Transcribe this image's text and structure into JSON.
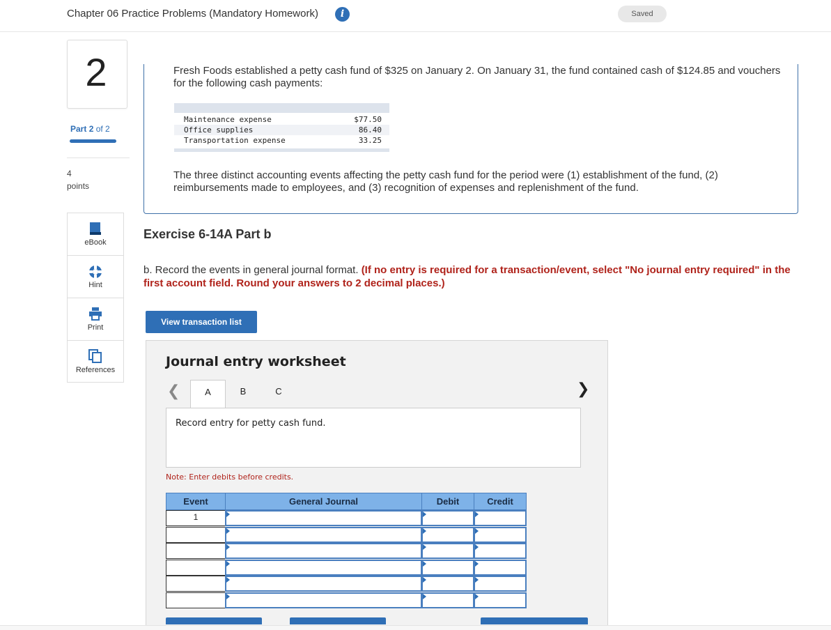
{
  "header": {
    "title": "Chapter 06 Practice Problems (Mandatory Homework)",
    "info_icon": "i",
    "saved": "Saved"
  },
  "rail": {
    "question_number": "2",
    "part_word": "Part",
    "part_current": "2",
    "part_of": "of 2",
    "progress": 1.0,
    "points_value": "4",
    "points_label": "points",
    "tools": [
      {
        "label": "eBook",
        "icon": "book-icon"
      },
      {
        "label": "Hint",
        "icon": "hint-icon"
      },
      {
        "label": "Print",
        "icon": "print-icon"
      },
      {
        "label": "References",
        "icon": "references-icon"
      }
    ]
  },
  "question": {
    "intro": "Fresh Foods established a petty cash fund of $325 on January 2. On January 31, the fund contained cash of $124.85 and vouchers for the following cash payments:",
    "payments": [
      {
        "account": "Maintenance expense",
        "amount": "$77.50"
      },
      {
        "account": "Office supplies",
        "amount": "86.40"
      },
      {
        "account": "Transportation expense",
        "amount": "33.25"
      }
    ],
    "events_text": "The three distinct accounting events affecting the petty cash fund for the period were (1) establishment of the fund, (2) reimbursements made to employees, and (3) recognition of expenses and replenishment of the fund."
  },
  "exercise": {
    "title": "Exercise 6-14A Part b",
    "instruction_plain": "b. Record the events in general journal format.",
    "instruction_red": "(If no entry is required for a transaction/event, select \"No journal entry required\" in the first account field. Round your answers to 2 decimal places.)",
    "view_button": "View transaction list"
  },
  "worksheet": {
    "title": "Journal entry worksheet",
    "tabs": [
      "A",
      "B",
      "C"
    ],
    "active_tab": "A",
    "entry_prompt": "Record entry for petty cash fund.",
    "note": "Note: Enter debits before credits.",
    "columns": [
      "Event",
      "General Journal",
      "Debit",
      "Credit"
    ],
    "rows": [
      {
        "event": "1",
        "account": "",
        "debit": "",
        "credit": ""
      },
      {
        "event": "",
        "account": "",
        "debit": "",
        "credit": ""
      },
      {
        "event": "",
        "account": "",
        "debit": "",
        "credit": ""
      },
      {
        "event": "",
        "account": "",
        "debit": "",
        "credit": ""
      },
      {
        "event": "",
        "account": "",
        "debit": "",
        "credit": ""
      },
      {
        "event": "",
        "account": "",
        "debit": "",
        "credit": ""
      }
    ]
  }
}
